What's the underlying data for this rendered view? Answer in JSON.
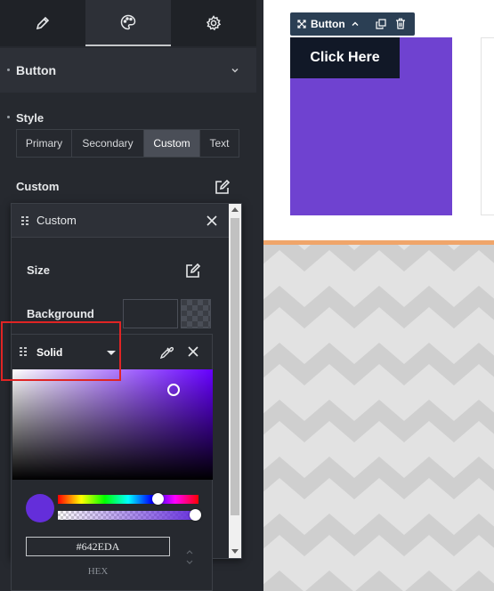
{
  "panel": {
    "tabs": [
      {
        "icon": "pencil-icon"
      },
      {
        "icon": "palette-icon",
        "active": true
      },
      {
        "icon": "gear-icon"
      }
    ],
    "section_title": "Button",
    "style": {
      "label": "Style",
      "options": [
        "Primary",
        "Secondary",
        "Custom",
        "Text"
      ],
      "selected": "Custom"
    },
    "custom_label": "Custom"
  },
  "custom_popover": {
    "title": "Custom",
    "size_label": "Size",
    "background_label": "Background"
  },
  "color_picker": {
    "mode": "Solid",
    "hex_value": "#642EDA",
    "hex_label": "HEX",
    "hue_color": "#6600ff",
    "selected_color": "#642EDA"
  },
  "canvas": {
    "element_label": "Button",
    "button_text": "Click Here",
    "box_color": "#6F42D0",
    "accent_color": "#F0A56A"
  }
}
